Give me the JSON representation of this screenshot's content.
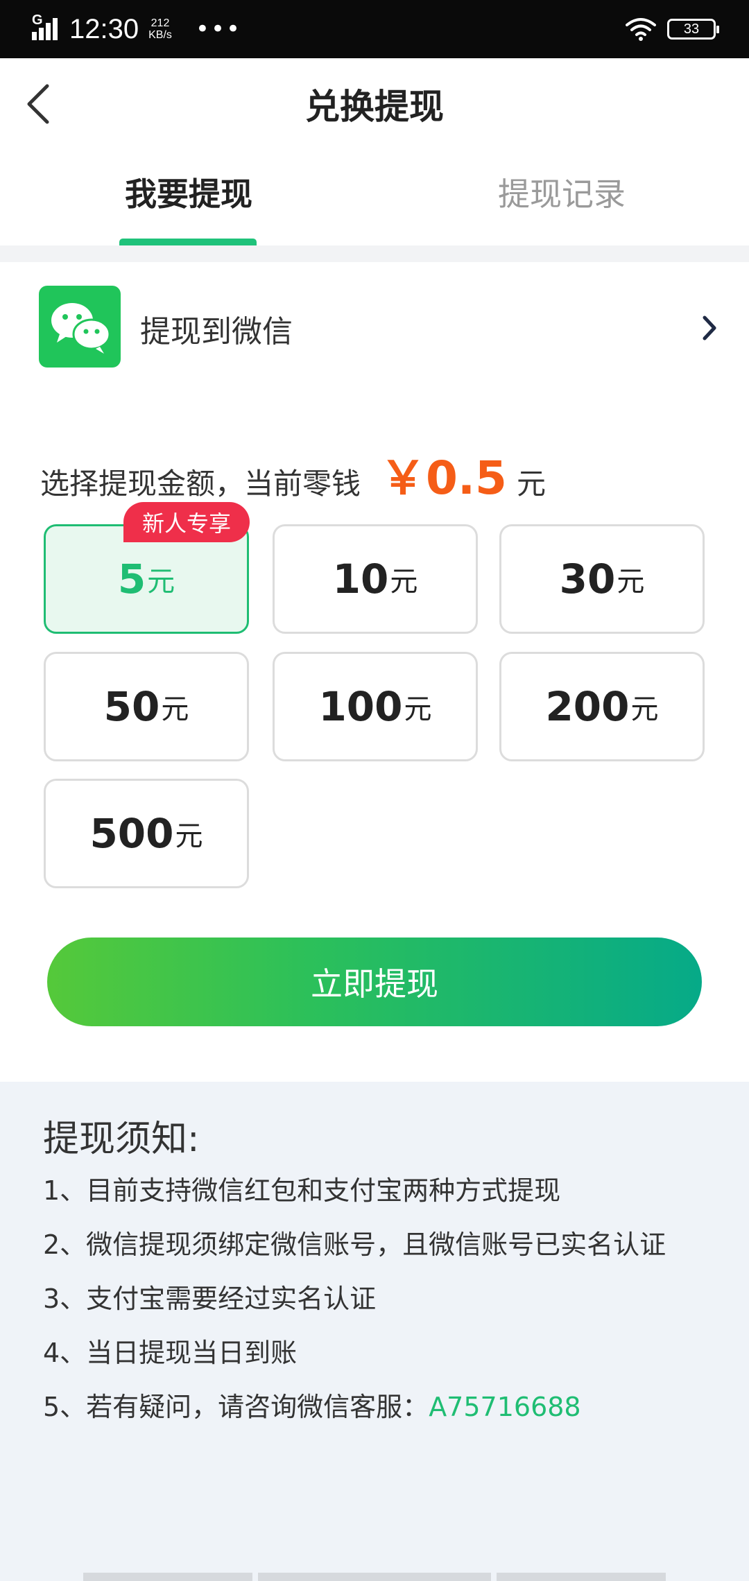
{
  "status_bar": {
    "network": "G",
    "time": "12:30",
    "speed_value": "212",
    "speed_unit": "KB/s",
    "more": "•••",
    "battery": "33"
  },
  "header": {
    "title": "兑换提现"
  },
  "tabs": [
    {
      "label": "我要提现",
      "active": true
    },
    {
      "label": "提现记录",
      "active": false
    }
  ],
  "method": {
    "label": "提现到微信"
  },
  "amount": {
    "prompt": "选择提现金额，当前零钱",
    "balance": "￥0.5",
    "unit": "元"
  },
  "options": [
    {
      "value": "5",
      "unit": "元",
      "selected": true,
      "badge": "新人专享"
    },
    {
      "value": "10",
      "unit": "元"
    },
    {
      "value": "30",
      "unit": "元"
    },
    {
      "value": "50",
      "unit": "元"
    },
    {
      "value": "100",
      "unit": "元"
    },
    {
      "value": "200",
      "unit": "元"
    },
    {
      "value": "500",
      "unit": "元"
    }
  ],
  "submit_label": "立即提现",
  "notice": {
    "title": "提现须知:",
    "items": [
      "1、目前支持微信红包和支付宝两种方式提现",
      "2、微信提现须绑定微信账号，且微信账号已实名认证",
      "3、支付宝需要经过实名认证",
      "4、当日提现当日到账",
      "5、若有疑问，请咨询微信客服："
    ],
    "service_id": "A75716688"
  },
  "colors": {
    "accent": "#1fbd73",
    "balance": "#f55d17",
    "badge": "#ef2f4a",
    "wechat": "#20c55a"
  }
}
